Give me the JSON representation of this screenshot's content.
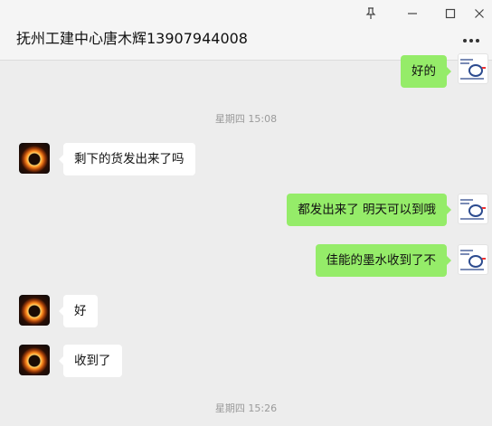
{
  "window": {
    "title": "抚州工建中心唐木辉13907944008"
  },
  "messages": [
    {
      "side": "out",
      "text": "好的"
    },
    {
      "type": "timestamp",
      "text": "星期四 15:08"
    },
    {
      "side": "in",
      "text": "剩下的货发出来了吗"
    },
    {
      "side": "out",
      "text": "都发出来了  明天可以到哦"
    },
    {
      "side": "out",
      "text": "佳能的墨水收到了不"
    },
    {
      "side": "in",
      "text": "好"
    },
    {
      "side": "in",
      "text": "收到了"
    },
    {
      "type": "timestamp",
      "text": "星期四 15:26"
    }
  ],
  "icons": {
    "pin": "pin-icon",
    "minimize": "minimize-icon",
    "maximize": "maximize-icon",
    "close": "close-icon",
    "more": "more-options-icon"
  },
  "colors": {
    "outgoing_bubble": "#95ec69",
    "incoming_bubble": "#ffffff",
    "chat_background": "#ededed"
  }
}
